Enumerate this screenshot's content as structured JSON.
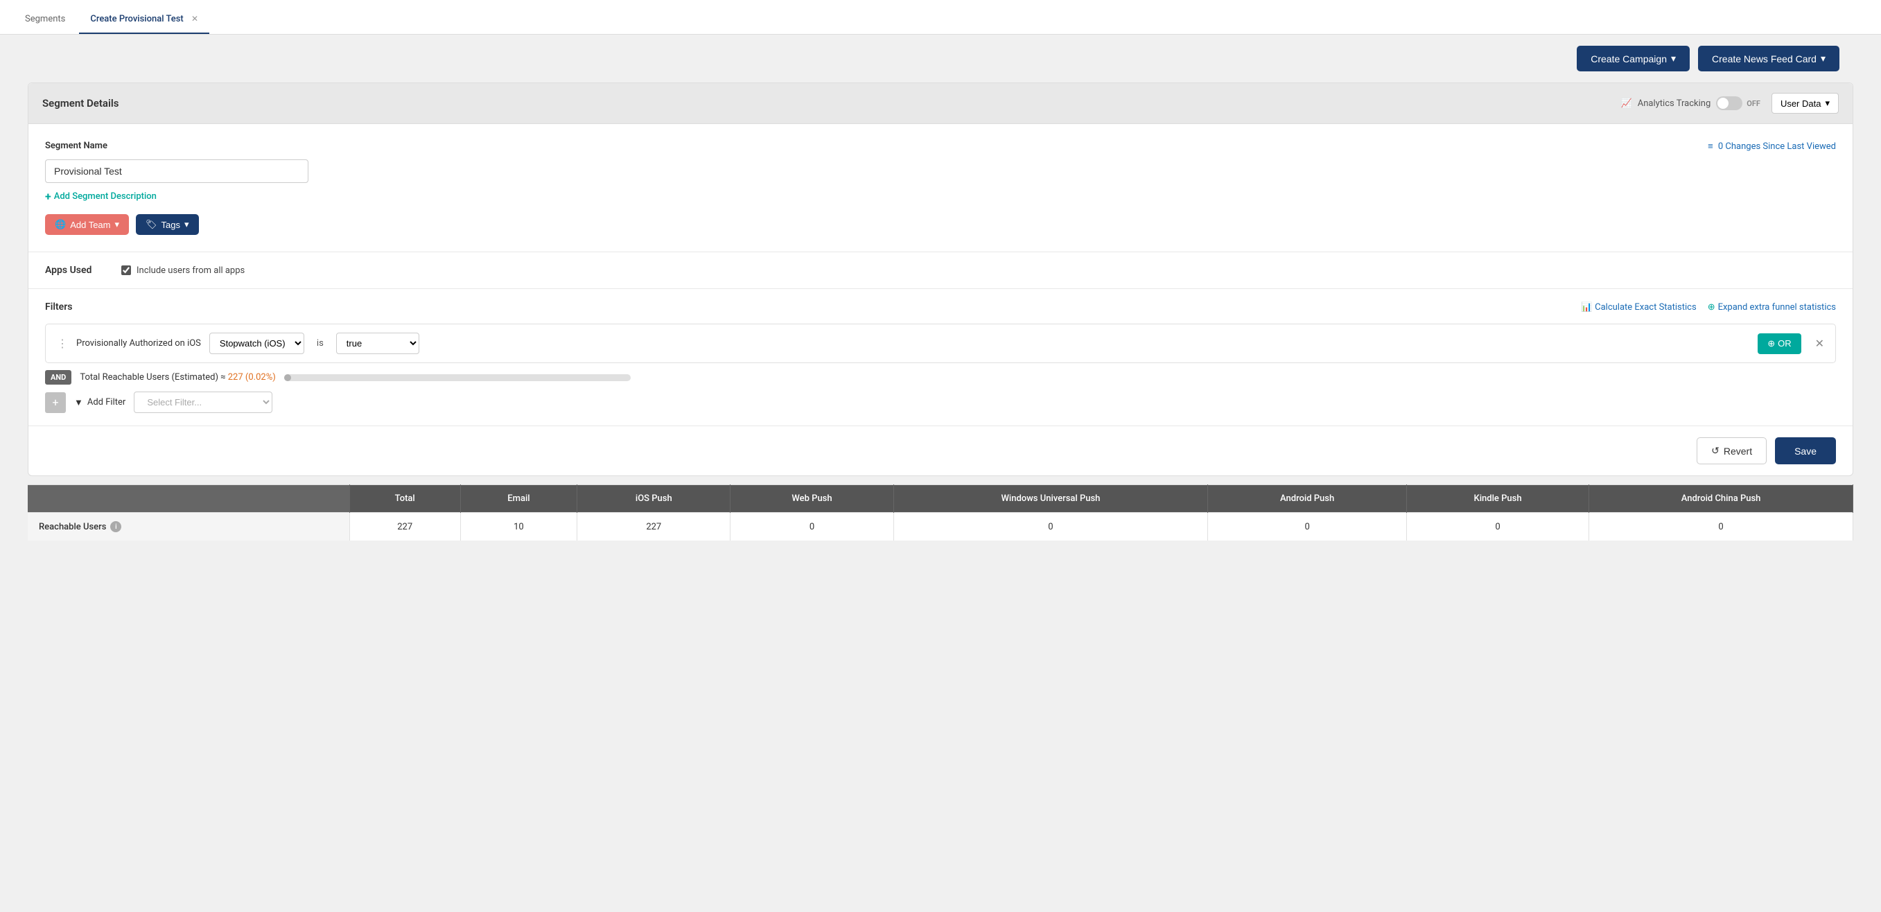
{
  "tabs": [
    {
      "label": "Segments",
      "active": false,
      "closeable": false
    },
    {
      "label": "Create Provisional Test",
      "active": true,
      "closeable": true
    }
  ],
  "topActions": {
    "createCampaign": "Create Campaign",
    "createFeedCard": "Create News Feed Card"
  },
  "segmentDetails": {
    "title": "Segment Details",
    "analyticsLabel": "Analytics Tracking",
    "toggleState": "OFF",
    "userDataLabel": "User Data",
    "changesLabel": "0 Changes Since Last Viewed",
    "segmentNameLabel": "Segment Name",
    "segmentNameValue": "Provisional Test",
    "addDescriptionLabel": "Add Segment Description",
    "addTeamLabel": "Add Team",
    "tagsLabel": "Tags"
  },
  "appsUsed": {
    "label": "Apps Used",
    "checkboxLabel": "Include users from all apps",
    "checked": true
  },
  "filters": {
    "title": "Filters",
    "calcExactStats": "Calculate Exact Statistics",
    "expandFunnel": "Expand extra funnel statistics",
    "filterRow": {
      "text": "Provisionally Authorized on iOS",
      "appSelect": "Stopwatch (iOS)",
      "isLabel": "is",
      "valueSelect": "true",
      "orLabel": "OR"
    },
    "andBadge": "AND",
    "reachableText": "Total Reachable Users (Estimated) ≈",
    "reachableCount": "227",
    "reachablePercent": "(0.02%)",
    "progressPercent": 2,
    "addFilterLabel": "Add Filter",
    "selectFilterPlaceholder": "Select Filter..."
  },
  "footer": {
    "revertLabel": "Revert",
    "saveLabel": "Save"
  },
  "table": {
    "headers": [
      "",
      "Total",
      "Email",
      "iOS Push",
      "Web Push",
      "Windows Universal Push",
      "Android Push",
      "Kindle Push",
      "Android China Push"
    ],
    "rows": [
      {
        "label": "Reachable Users",
        "values": [
          "227",
          "10",
          "227",
          "0",
          "0",
          "0",
          "0",
          "0"
        ]
      }
    ]
  }
}
